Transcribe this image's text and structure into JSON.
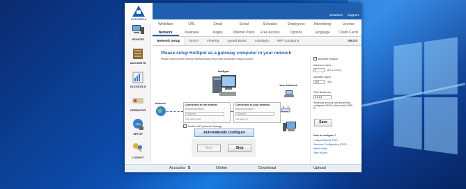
{
  "titlebar": {
    "logo_text": "ANTAMEDIA",
    "links": [
      "Solutions",
      "Support"
    ]
  },
  "menu_row1": [
    "Whitelists",
    "URL",
    "Email",
    "Social",
    "Schedule",
    "Employees",
    "Advertising",
    "License"
  ],
  "menu_row2": {
    "items": [
      "Network",
      "Database",
      "Pages",
      "Internet Plans",
      "Free Access",
      "Options",
      "Language",
      "Credit Cards"
    ],
    "active": "Network"
  },
  "subtabs": {
    "items": [
      "Network Setup",
      "DHCP",
      "Filtering",
      "Speed Boost",
      "Autologin",
      "WiFi Locations"
    ],
    "active": "Network Setup",
    "version": "V6.0.0"
  },
  "sidebar": {
    "items": [
      {
        "label": "DEVICES",
        "icon": "devices-icon"
      },
      {
        "label": "ACCOUNTS",
        "icon": "accounts-icon"
      },
      {
        "label": "STATISTICS",
        "icon": "statistics-icon"
      },
      {
        "label": "OPERATOR",
        "icon": "operator-icon"
      },
      {
        "label": "SETUP",
        "icon": "setup-icon"
      },
      {
        "label": "LOGOUT",
        "icon": "logout-icon"
      }
    ]
  },
  "main": {
    "title": "Please setup HotSpot as a gateway computer in your network",
    "subtitle": "Please select correct network interfaces and press Start to activate HotSpot control."
  },
  "diagram": {
    "internet_label": "Internet",
    "hotspot_label": "HotSpot",
    "your_network_label": "Your Network",
    "internet_box": {
      "title": "Connected to the Internet",
      "iface": "Network Interface 1",
      "select": "Ethernet0",
      "ip": "192.168.70.128"
    },
    "network_box": {
      "title": "Connected to your network",
      "iface": "Network Interface 2",
      "select": "Ethernet1",
      "ip": "192.168.10.1"
    },
    "nat_label": "Enable NAT (Internet Sharing)"
  },
  "buttons": {
    "auto_configure": "Automatically Configure",
    "start": "Start",
    "stop": "Stop",
    "save": "Save"
  },
  "right_panel": {
    "autostart": "Autostart Hotspot",
    "max_users_label": "Maximum users",
    "max_users_value": "5",
    "buy_license": "Buy License",
    "inactivity_label": "Inactivity logout",
    "inactivity_value": "300",
    "inactivity_unit": "Sec",
    "dns_label": "DNS Redirector",
    "dns_value": "8.8.8.8",
    "redirect_note": "Redirects devices with incorrectly configured DNS to the correct DNS IP",
    "how_to_title": "How to configure ?",
    "help_links": [
      "Hotspot Manual (PDF)",
      "Windows Configuration (PDF)",
      "Watch Video",
      "Start Wizard"
    ]
  },
  "statusbar": {
    "accounts_label": "Accounts",
    "accounts_count": "5",
    "online": "Online",
    "download": "Download",
    "upload": "Upload"
  },
  "colors": {
    "brand_blue": "#1f5fae",
    "desktop_blue": "#0d4fb0"
  }
}
